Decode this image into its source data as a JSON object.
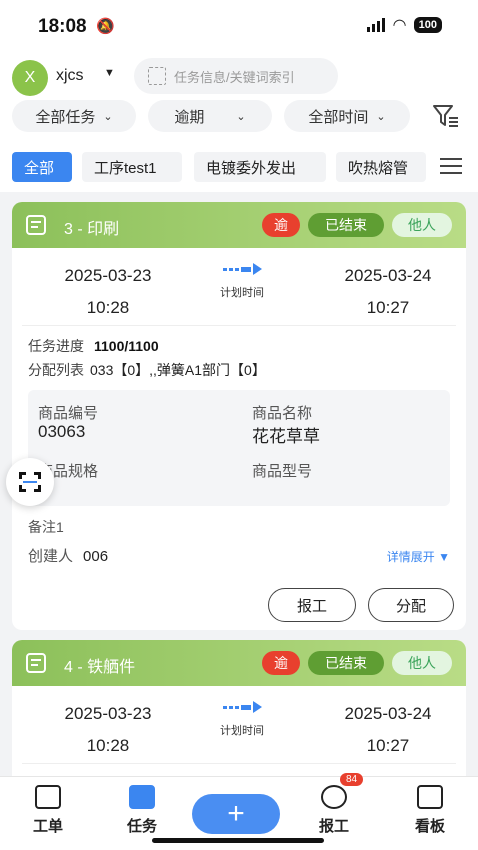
{
  "status": {
    "time": "18:08",
    "battery": "100"
  },
  "header": {
    "avatar_letter": "X",
    "user_name": "xjcs",
    "search_placeholder": "任务信息/关键词索引"
  },
  "filters": [
    {
      "label": "全部任务"
    },
    {
      "label": "逾期"
    },
    {
      "label": "全部时间"
    }
  ],
  "tabs": [
    {
      "label": "全部",
      "active": true
    },
    {
      "label": "工序test1"
    },
    {
      "label": "电镀委外发出"
    },
    {
      "label": "吹热熔管"
    }
  ],
  "cards": [
    {
      "title": "3 - 印刷",
      "badges": {
        "overdue": "逾",
        "status": "已结束",
        "owner": "他人"
      },
      "start_date": "2025-03-23",
      "start_time": "10:28",
      "plan_label": "计划时间",
      "end_date": "2025-03-24",
      "end_time": "10:27",
      "progress_label": "任务进度",
      "progress_value": "1100/1100",
      "assign_label": "分配列表",
      "assign_value": "033【0】,,弹簧A1部门【0】",
      "goods": {
        "code_label": "商品编号",
        "code_value": "03063",
        "name_label": "商品名称",
        "name_value": "花花草草",
        "spec_label": "商品规格",
        "model_label": "商品型号"
      },
      "remark": "备注1",
      "creator_label": "创建人",
      "creator_value": "006",
      "expand_label": "详情展开",
      "report_button": "报工",
      "assign_button": "分配"
    },
    {
      "title": "4 - 铁舾件",
      "badges": {
        "overdue": "逾",
        "status": "已结束",
        "owner": "他人"
      },
      "start_date": "2025-03-23",
      "start_time": "10:28",
      "plan_label": "计划时间",
      "end_date": "2025-03-24",
      "end_time": "10:27"
    }
  ],
  "tabbar": {
    "items": [
      {
        "label": "工单",
        "icon": "work-order-icon"
      },
      {
        "label": "任务",
        "icon": "task-icon",
        "active": true
      },
      {
        "label": "报工",
        "icon": "timer-icon",
        "badge": "84"
      },
      {
        "label": "看板",
        "icon": "board-icon"
      }
    ],
    "add_symbol": "+"
  },
  "colors": {
    "accent": "#3b86f0",
    "card_header": "#8cc05a",
    "overdue": "#e8402e",
    "ended": "#5f9e33"
  }
}
